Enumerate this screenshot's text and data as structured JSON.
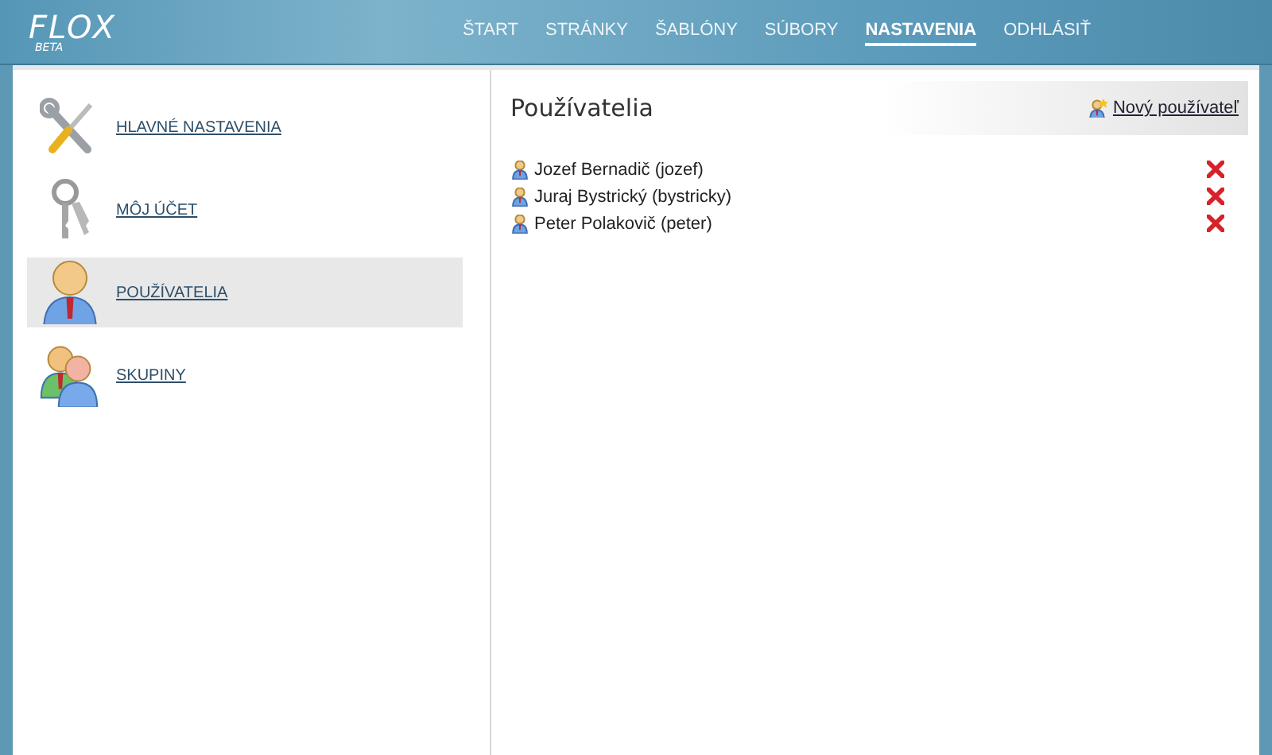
{
  "logo": {
    "name": "FLOX",
    "tag": "BETA"
  },
  "nav": [
    {
      "label": "ŠTART",
      "selected": false
    },
    {
      "label": "STRÁNKY",
      "selected": false
    },
    {
      "label": "ŠABLÓNY",
      "selected": false
    },
    {
      "label": "SÚBORY",
      "selected": false
    },
    {
      "label": "NASTAVENIA",
      "selected": true
    },
    {
      "label": "ODHLÁSIŤ",
      "selected": false
    }
  ],
  "sidebar": {
    "items": [
      {
        "label": "HLAVNÉ NASTAVENIA",
        "kind": "tools",
        "selected": false
      },
      {
        "label": "MÔJ ÚČET",
        "kind": "keys",
        "selected": false
      },
      {
        "label": "POUŽÍVATELIA",
        "kind": "user",
        "selected": true
      },
      {
        "label": "SKUPINY",
        "kind": "group",
        "selected": false
      }
    ]
  },
  "content": {
    "title": "Používatelia",
    "action": "Nový používateľ",
    "users": [
      {
        "name": "Jozef Bernadič (jozef)"
      },
      {
        "name": "Juraj Bystrický (bystricky)"
      },
      {
        "name": "Peter Polakovič (peter)"
      }
    ]
  }
}
